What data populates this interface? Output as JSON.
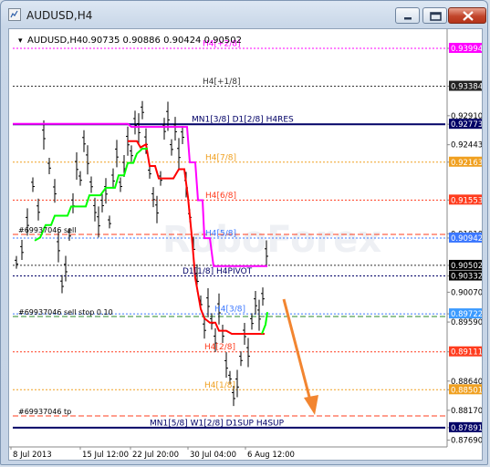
{
  "window": {
    "title": "AUDUSD,H4",
    "buttons": [
      "minimize",
      "restore",
      "close"
    ]
  },
  "chart_header": {
    "symbol_label": "AUDUSD,H4",
    "ohlc": "0.90735 0.90886 0.90424 0.90502"
  },
  "watermark": "RoboForex",
  "chart_data": {
    "type": "candlestick",
    "ylim": [
      0.8761,
      0.9428
    ],
    "y_ticks": [
      {
        "value": 0.93994,
        "label": "0.93994",
        "color": "#ff00ff"
      },
      {
        "value": 0.93384,
        "label": "0.93384",
        "color": "#222222"
      },
      {
        "value": 0.9291,
        "label": "0.92910",
        "color": null
      },
      {
        "value": 0.92773,
        "label": "0.92773",
        "color": "#000066"
      },
      {
        "value": 0.92443,
        "label": "0.92443",
        "color": null
      },
      {
        "value": 0.92163,
        "label": "0.92163",
        "color": "#f0a020"
      },
      {
        "value": 0.91553,
        "label": "0.91553",
        "color": "#ff3c1e"
      },
      {
        "value": 0.9101,
        "label": "0.91010",
        "color": null
      },
      {
        "value": 0.90942,
        "label": "0.90942",
        "color": "#3c78ff"
      },
      {
        "value": 0.90502,
        "label": "0.90502",
        "color": "#000000"
      },
      {
        "value": 0.90332,
        "label": "0.90332",
        "color": "#000000"
      },
      {
        "value": 0.9007,
        "label": "0.90070",
        "color": null
      },
      {
        "value": 0.89722,
        "label": "0.89722",
        "color": "#3c9bff"
      },
      {
        "value": 0.8959,
        "label": "0.89590",
        "color": null
      },
      {
        "value": 0.89111,
        "label": "0.89111",
        "color": "#ff3c1e"
      },
      {
        "value": 0.8864,
        "label": "0.88640",
        "color": null
      },
      {
        "value": 0.88501,
        "label": "0.88501",
        "color": "#f0a020"
      },
      {
        "value": 0.8817,
        "label": "0.88170",
        "color": null
      },
      {
        "value": 0.87891,
        "label": "0.87891",
        "color": "#000066"
      },
      {
        "value": 0.8769,
        "label": "0.87690",
        "color": null
      }
    ],
    "x_labels": [
      "8 Jul 2013",
      "15 Jul 12:00",
      "22 Jul 20:00",
      "30 Jul 04:00",
      "6 Aug 12:00"
    ],
    "levels": [
      {
        "value": 0.93994,
        "label": "H4[+2/8]",
        "color": "#ff00ff",
        "style": "dot"
      },
      {
        "value": 0.93384,
        "label": "H4[+1/8]",
        "color": "#333333",
        "style": "dot"
      },
      {
        "value": 0.92773,
        "label": "MN1[3/8] D1[2/8] H4RES",
        "color": "#000066",
        "style": "solid"
      },
      {
        "value": 0.92163,
        "label": "H4[7/8]",
        "color": "#f0a020",
        "style": "dot"
      },
      {
        "value": 0.91553,
        "label": "H4[6/8]",
        "color": "#ff3c1e",
        "style": "dot"
      },
      {
        "value": 0.90942,
        "label": "H4[5/8]",
        "color": "#3c78ff",
        "style": "dot"
      },
      {
        "value": 0.90332,
        "label": "D1[1/8] H4PIVOT",
        "color": "#000066",
        "style": "dot"
      },
      {
        "value": 0.89722,
        "label": "H4[3/8]",
        "color": "#3c78ff",
        "style": "dot"
      },
      {
        "value": 0.89111,
        "label": "H4[2/8]",
        "color": "#ff3c1e",
        "style": "dot"
      },
      {
        "value": 0.88501,
        "label": "H4[1/8]",
        "color": "#f0a020",
        "style": "dot"
      },
      {
        "value": 0.87891,
        "label": "MN1[5/8] W1[2/8] D1SUP H4SUP",
        "color": "#000066",
        "style": "solid"
      }
    ],
    "orders": [
      {
        "value": 0.91,
        "label": "#69937046 sell",
        "color": "#ff3c1e"
      },
      {
        "value": 0.8968,
        "label": "#69937046 sell stop 0.10",
        "color": "#2a8a2a"
      },
      {
        "value": 0.8808,
        "label": "#69937046 tp",
        "color": "#ff3c1e"
      }
    ],
    "bid_price": 0.90502,
    "arrow": {
      "direction": "down",
      "color": "#f28530"
    }
  },
  "colors": {
    "window_bg": "#c6d4e6",
    "chart_bg": "#ffffff",
    "candles": "#000000",
    "magenta_line": "#ff00ff",
    "red_line": "#ff0000",
    "green_line": "#00ff00"
  }
}
